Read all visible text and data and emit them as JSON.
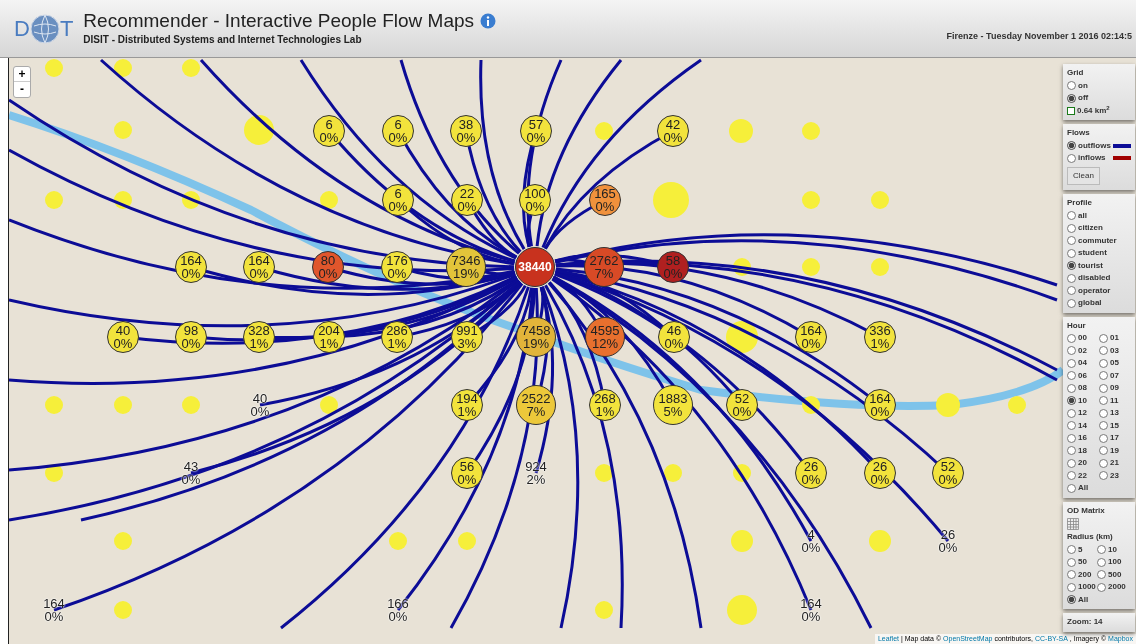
{
  "header": {
    "logo": {
      "left": "D",
      "right": "T"
    },
    "title": "Recommender - Interactive People Flow Maps",
    "subtitle": "DISIT - Distributed Systems and Internet Technologies Lab",
    "datetime": "Firenze - Tuesday November 1 2016 02:14:5"
  },
  "map_controls": {
    "zoom_in": "+",
    "zoom_out": "-"
  },
  "markers": [
    {
      "count": "6",
      "share": "0%",
      "color": "#f2e33c"
    },
    {
      "count": "6",
      "share": "0%",
      "color": "#f2e33c"
    },
    {
      "count": "38",
      "share": "0%",
      "color": "#f2e33c"
    },
    {
      "count": "57",
      "share": "0%",
      "color": "#f2e33c"
    },
    {
      "count": "42",
      "share": "0%",
      "color": "#f2e33c"
    },
    {
      "count": "6",
      "share": "0%",
      "color": "#f2e33c"
    },
    {
      "count": "22",
      "share": "0%",
      "color": "#f2e33c"
    },
    {
      "count": "100",
      "share": "0%",
      "color": "#f2e33c"
    },
    {
      "count": "165",
      "share": "0%",
      "color": "#f0913c"
    },
    {
      "count": "164",
      "share": "0%",
      "color": "#f2e33c"
    },
    {
      "count": "164",
      "share": "0%",
      "color": "#f2e33c"
    },
    {
      "count": "80",
      "share": "0%",
      "color": "#e0562c"
    },
    {
      "count": "176",
      "share": "0%",
      "color": "#f2e33c"
    },
    {
      "count": "7346",
      "share": "19%",
      "color": "#e2c43a"
    },
    {
      "count": "38440",
      "color": "#c8321e"
    },
    {
      "count": "2762",
      "share": "7%",
      "color": "#d84a26"
    },
    {
      "count": "58",
      "share": "0%",
      "color": "#b02020"
    },
    {
      "count": "40",
      "share": "0%",
      "color": "#f2e33c"
    },
    {
      "count": "98",
      "share": "0%",
      "color": "#f2e33c"
    },
    {
      "count": "328",
      "share": "1%",
      "color": "#f2e33c"
    },
    {
      "count": "204",
      "share": "1%",
      "color": "#f2e33c"
    },
    {
      "count": "286",
      "share": "1%",
      "color": "#f2e33c"
    },
    {
      "count": "991",
      "share": "3%",
      "color": "#f2e33c"
    },
    {
      "count": "7458",
      "share": "19%",
      "color": "#e2b43a"
    },
    {
      "count": "4595",
      "share": "12%",
      "color": "#e8702e"
    },
    {
      "count": "46",
      "share": "0%",
      "color": "#f2e33c"
    },
    {
      "count": "164",
      "share": "0%",
      "color": "#f2e33c"
    },
    {
      "count": "336",
      "share": "1%",
      "color": "#f2e33c"
    },
    {
      "count": "40",
      "share": "0%"
    },
    {
      "count": "194",
      "share": "1%",
      "color": "#f2e33c"
    },
    {
      "count": "2522",
      "share": "7%",
      "color": "#ecc83a"
    },
    {
      "count": "268",
      "share": "1%",
      "color": "#f2e33c"
    },
    {
      "count": "1883",
      "share": "5%",
      "color": "#f2e33c"
    },
    {
      "count": "52",
      "share": "0%",
      "color": "#f2e33c"
    },
    {
      "count": "164",
      "share": "0%",
      "color": "#f2e33c"
    },
    {
      "count": "43",
      "share": "0%"
    },
    {
      "count": "56",
      "share": "0%",
      "color": "#f2e33c"
    },
    {
      "count": "924",
      "share": "2%"
    },
    {
      "count": "26",
      "share": "0%",
      "color": "#f2e33c"
    },
    {
      "count": "26",
      "share": "0%",
      "color": "#f2e33c"
    },
    {
      "count": "52",
      "share": "0%",
      "color": "#f2e33c"
    },
    {
      "count": "4",
      "share": "0%"
    },
    {
      "count": "26",
      "share": "0%"
    },
    {
      "count": "164",
      "share": "0%"
    },
    {
      "count": "166",
      "share": "0%"
    },
    {
      "count": "164",
      "share": "0%"
    }
  ],
  "panel": {
    "grid": {
      "title": "Grid",
      "options": [
        {
          "label": "on",
          "selected": false
        },
        {
          "label": "off",
          "selected": true
        }
      ],
      "cell_size": "0.64 km$^{2}$"
    },
    "flows": {
      "title": "Flows",
      "options": [
        {
          "label": "outflows",
          "selected": true,
          "color": "#0c0c96"
        },
        {
          "label": "inflows",
          "selected": false,
          "color": "#a00000"
        }
      ],
      "button": "Clean"
    },
    "profile": {
      "title": "Profile",
      "options": [
        {
          "label": "all",
          "selected": false
        },
        {
          "label": "citizen",
          "selected": false
        },
        {
          "label": "commuter",
          "selected": false
        },
        {
          "label": "student",
          "selected": false
        },
        {
          "label": "tourist",
          "selected": true
        },
        {
          "label": "disabled",
          "selected": false
        },
        {
          "label": "operator",
          "selected": false
        },
        {
          "label": "global",
          "selected": false
        }
      ]
    },
    "hour": {
      "title": "Hour",
      "options": [
        {
          "label": "00",
          "selected": false
        },
        {
          "label": "01",
          "selected": false
        },
        {
          "label": "02",
          "selected": false
        },
        {
          "label": "03",
          "selected": false
        },
        {
          "label": "04",
          "selected": false
        },
        {
          "label": "05",
          "selected": false
        },
        {
          "label": "06",
          "selected": false
        },
        {
          "label": "07",
          "selected": false
        },
        {
          "label": "08",
          "selected": false
        },
        {
          "label": "09",
          "selected": false
        },
        {
          "label": "10",
          "selected": true
        },
        {
          "label": "11",
          "selected": false
        },
        {
          "label": "12",
          "selected": false
        },
        {
          "label": "13",
          "selected": false
        },
        {
          "label": "14",
          "selected": false
        },
        {
          "label": "15",
          "selected": false
        },
        {
          "label": "16",
          "selected": false
        },
        {
          "label": "17",
          "selected": false
        },
        {
          "label": "18",
          "selected": false
        },
        {
          "label": "19",
          "selected": false
        },
        {
          "label": "20",
          "selected": false
        },
        {
          "label": "21",
          "selected": false
        },
        {
          "label": "22",
          "selected": false
        },
        {
          "label": "23",
          "selected": false
        },
        {
          "label": "All",
          "selected": false
        }
      ]
    },
    "od_matrix": {
      "title": "OD Matrix",
      "radius_title": "Radius (km)",
      "options": [
        {
          "label": "5",
          "selected": false
        },
        {
          "label": "10",
          "selected": false
        },
        {
          "label": "50",
          "selected": false
        },
        {
          "label": "100",
          "selected": false
        },
        {
          "label": "200",
          "selected": false
        },
        {
          "label": "500",
          "selected": false
        },
        {
          "label": "1000",
          "selected": false
        },
        {
          "label": "2000",
          "selected": false
        },
        {
          "label": "All",
          "selected": true
        }
      ]
    },
    "zoom": "Zoom: 14"
  },
  "attribution": {
    "leaflet": "Leaflet",
    "map_data": "| Map data ©",
    "osm": "OpenStreetMap",
    "contributors": "contributors,",
    "license": "CC-BY-SA",
    "imagery": ", Imagery ©",
    "provider": "Mapbox"
  }
}
